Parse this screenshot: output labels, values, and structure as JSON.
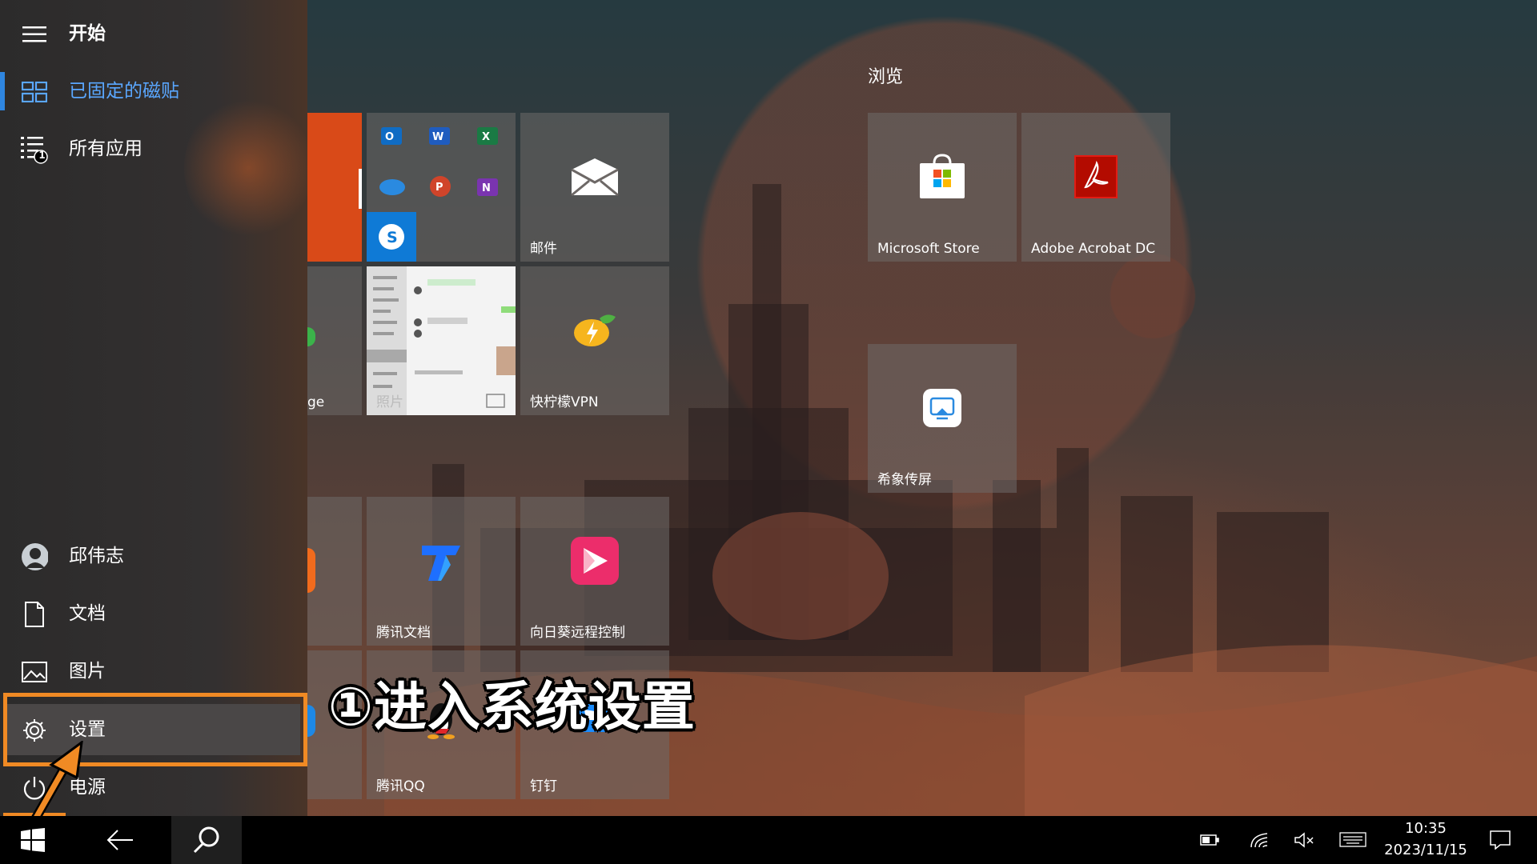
{
  "start_menu": {
    "title": "开始",
    "nav": {
      "pinned": "已固定的磁贴",
      "all_apps": "所有应用",
      "all_apps_badge": "1"
    },
    "user": "邱伟志",
    "documents": "文档",
    "pictures": "图片",
    "settings": "设置",
    "power": "电源"
  },
  "tiles": {
    "group_browse": "浏览",
    "mail": "邮件",
    "edge_partial": "ge",
    "photos": "照片",
    "vpn": "快柠檬VPN",
    "store": "Microsoft Store",
    "acrobat": "Adobe Acrobat DC",
    "xixiang": "希象传屏",
    "tencent_docs": "腾讯文档",
    "sunlogin": "向日葵远程控制",
    "qq": "腾讯QQ",
    "dingtalk": "钉钉"
  },
  "annotation": "①进入系统设置",
  "taskbar": {
    "time": "10:35",
    "date": "2023/11/15"
  },
  "colors": {
    "accent": "#2f86e0",
    "highlight_orange": "#f08a24",
    "office_orange": "#d94a18"
  }
}
